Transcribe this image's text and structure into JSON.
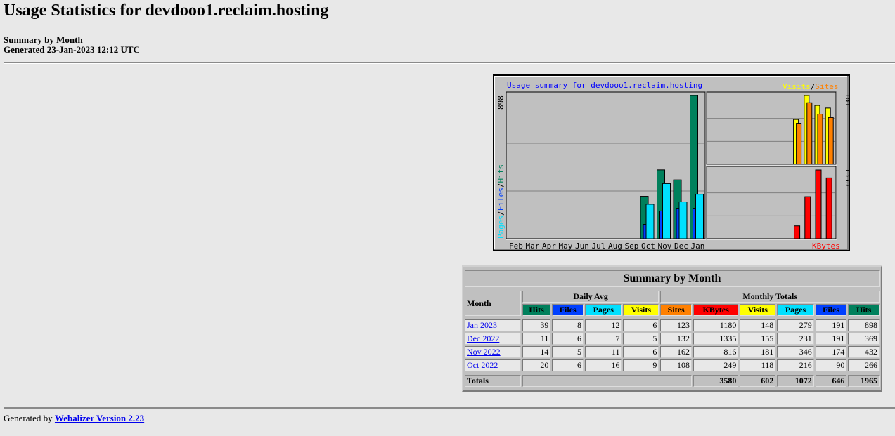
{
  "page": {
    "title": "Usage Statistics for devdooo1.reclaim.hosting",
    "summary_line": "Summary by Month",
    "generated_line": "Generated 23-Jan-2023 12:12 UTC"
  },
  "graph": {
    "title": "Usage summary for devdooo1.reclaim.hosting",
    "legend_visits": "Visits",
    "legend_sep": "/",
    "legend_sites": "Sites",
    "legend_pages": "Pages",
    "legend_files": "Files",
    "legend_hits": "Hits",
    "legend_kbytes": "KBytes",
    "max_hits_label": "898",
    "max_visits_label": "181",
    "max_kbytes_label": "1335",
    "colors": {
      "hits": "#00805c",
      "files": "#0040ff",
      "pages": "#00e0ff",
      "visits": "#ffff00",
      "sites": "#ff8000",
      "kbytes": "#ff0000"
    }
  },
  "chart_data": {
    "type": "bar",
    "months": [
      "Feb",
      "Mar",
      "Apr",
      "May",
      "Jun",
      "Jul",
      "Aug",
      "Sep",
      "Oct",
      "Nov",
      "Dec",
      "Jan"
    ],
    "series_daily": {
      "hits": [
        0,
        0,
        0,
        0,
        0,
        0,
        0,
        0,
        266,
        432,
        369,
        898
      ],
      "files": [
        0,
        0,
        0,
        0,
        0,
        0,
        0,
        0,
        90,
        174,
        191,
        191
      ],
      "pages": [
        0,
        0,
        0,
        0,
        0,
        0,
        0,
        0,
        216,
        346,
        231,
        279
      ]
    },
    "series_visits_sites": {
      "visits": [
        0,
        0,
        0,
        0,
        0,
        0,
        0,
        0,
        118,
        181,
        155,
        148
      ],
      "sites": [
        0,
        0,
        0,
        0,
        0,
        0,
        0,
        0,
        108,
        162,
        132,
        123
      ]
    },
    "series_kbytes": [
      0,
      0,
      0,
      0,
      0,
      0,
      0,
      0,
      249,
      816,
      1335,
      1180
    ],
    "hits_max": 898,
    "visits_max": 181,
    "kbytes_max": 1335
  },
  "table": {
    "title": "Summary by Month",
    "month_header": "Month",
    "daily_avg_header": "Daily Avg",
    "monthly_totals_header": "Monthly Totals",
    "daily_cols": [
      "Hits",
      "Files",
      "Pages",
      "Visits"
    ],
    "monthly_cols": [
      "Sites",
      "KBytes",
      "Visits",
      "Pages",
      "Files",
      "Hits"
    ],
    "rows": [
      {
        "month": "Jan 2023",
        "d": [
          "39",
          "8",
          "12",
          "6"
        ],
        "m": [
          "123",
          "1180",
          "148",
          "279",
          "191",
          "898"
        ]
      },
      {
        "month": "Dec 2022",
        "d": [
          "11",
          "6",
          "7",
          "5"
        ],
        "m": [
          "132",
          "1335",
          "155",
          "231",
          "191",
          "369"
        ]
      },
      {
        "month": "Nov 2022",
        "d": [
          "14",
          "5",
          "11",
          "6"
        ],
        "m": [
          "162",
          "816",
          "181",
          "346",
          "174",
          "432"
        ]
      },
      {
        "month": "Oct 2022",
        "d": [
          "20",
          "6",
          "16",
          "9"
        ],
        "m": [
          "108",
          "249",
          "118",
          "216",
          "90",
          "266"
        ]
      }
    ],
    "totals_label": "Totals",
    "totals": [
      "3580",
      "602",
      "1072",
      "646",
      "1965"
    ]
  },
  "footer": {
    "prefix": "Generated by",
    "link": "Webalizer Version 2.23"
  }
}
